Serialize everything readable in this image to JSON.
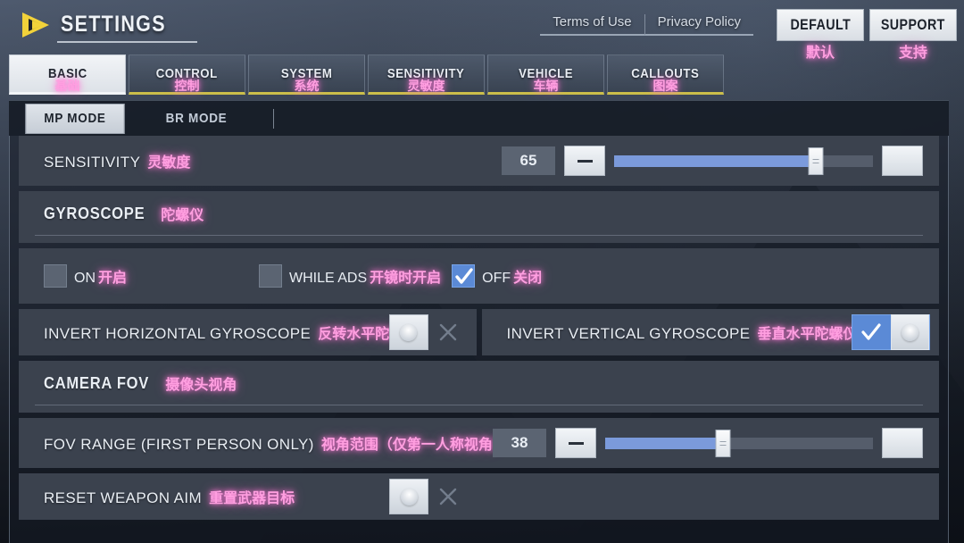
{
  "header": {
    "back_icon": "back-arrow-icon",
    "title": "SETTINGS",
    "links": [
      {
        "label": "Terms of Use"
      },
      {
        "label": "Privacy Policy"
      }
    ],
    "buttons": [
      {
        "en": "DEFAULT",
        "cn": "默认"
      },
      {
        "en": "SUPPORT",
        "cn": "支持"
      }
    ]
  },
  "tabs": [
    {
      "en": "BASIC",
      "cn": "基础",
      "active": true
    },
    {
      "en": "CONTROL",
      "cn": "控制",
      "active": false
    },
    {
      "en": "SYSTEM",
      "cn": "系统",
      "active": false
    },
    {
      "en": "SENSITIVITY",
      "cn": "灵敏度",
      "active": false
    },
    {
      "en": "VEHICLE",
      "cn": "车辆",
      "active": false
    },
    {
      "en": "CALLOUTS",
      "cn": "图案",
      "active": false
    }
  ],
  "subtabs": [
    {
      "label": "MP MODE",
      "active": true
    },
    {
      "label": "BR MODE",
      "active": false
    }
  ],
  "settings": {
    "sensitivity": {
      "en": "SENSITIVITY",
      "cn": "灵敏度",
      "value": "65",
      "fill_percent": 78,
      "minus_icon": "minus-icon",
      "plus_icon": "plus-icon"
    },
    "gyroscope_section": {
      "en": "GYROSCOPE",
      "cn": "陀螺仪"
    },
    "gyroscope_options": [
      {
        "en": "ON",
        "cn": "开启",
        "checked": false
      },
      {
        "en": "WHILE ADS",
        "cn": "开镜时开启",
        "checked": false
      },
      {
        "en": "OFF",
        "cn": "关闭",
        "checked": true
      }
    ],
    "invert_horizontal": {
      "en": "INVERT HORIZONTAL GYROSCOPE",
      "cn": "反转水平陀螺仪",
      "enabled": false,
      "off_icon": "x-icon"
    },
    "invert_vertical": {
      "en": "INVERT VERTICAL GYROSCOPE",
      "cn": "垂直水平陀螺仪",
      "enabled": true,
      "on_icon": "check-icon"
    },
    "camera_fov_section": {
      "en": "CAMERA FOV",
      "cn": "摄像头视角"
    },
    "fov_range": {
      "en": "FOV RANGE (FIRST PERSON ONLY)",
      "cn": "视角范围（仅第一人称视角）",
      "value": "38",
      "fill_percent": 44,
      "minus_icon": "minus-icon",
      "plus_icon": "plus-icon"
    },
    "reset_weapon_aim": {
      "en": "RESET WEAPON AIM",
      "cn": "重置武器目标",
      "enabled": false,
      "off_icon": "x-icon"
    }
  },
  "colors": {
    "accent_pink": "#ff9fe0",
    "accent_blue": "#5b8ad6",
    "tab_underline": "#cbbe4a",
    "row_bg": "#3b424e",
    "back_arrow": "#f2d23a"
  }
}
